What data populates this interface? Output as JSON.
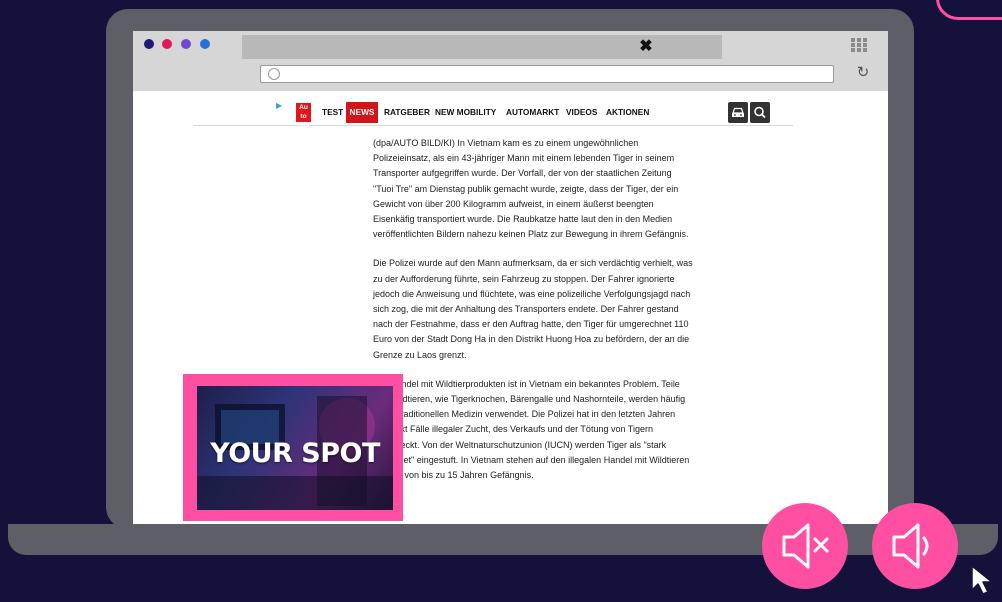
{
  "browser": {
    "tab_close_symbol": "✖",
    "reload_symbol": "↻",
    "traffic_dots": [
      "#1e1a78",
      "#e5145c",
      "#6c4bd0",
      "#2a6ed8"
    ]
  },
  "site": {
    "ad_marker": "▶",
    "logo_text": "Auto Bild",
    "nav_items": [
      "TEST",
      "NEWS",
      "RATGEBER",
      "NEW MOBILITY",
      "AUTOMARKT",
      "VIDEOS",
      "AKTIONEN"
    ],
    "active_nav": "NEWS"
  },
  "article": {
    "paragraphs": [
      "(dpa/AUTO BILD/KI) In Vietnam kam es zu einem ungewöhnlichen Polizeieinsatz, als ein 43-jähriger Mann mit einem lebenden Tiger in seinem Transporter aufgegriffen wurde. Der Vorfall, der von der staatlichen Zeitung \"Tuoi Tre\" am Dienstag publik gemacht wurde, zeigte, dass der Tiger, der ein Gewicht von über 200 Kilogramm aufweist, in einem äußerst beengten Eisenkäfig transportiert wurde. Die Raubkatze hatte laut den in den Medien veröffentlichten Bildern nahezu keinen Platz zur Bewegung in ihrem Gefängnis.",
      "Die Polizei wurde auf den Mann aufmerksam, da er sich verdächtig verhielt, was zu der Aufforderung führte, sein Fahrzeug zu stoppen. Der Fahrer ignorierte jedoch die Anweisung und flüchtete, was eine polizeiliche Verfolgungsjagd nach sich zog, die mit der Anhaltung des Transporters endete. Der Fahrer gestand nach der Festnahme, dass er den Auftrag hatte, den Tiger für umgerechnet 110 Euro von der Stadt Dong Ha in den Distrikt Huong Hoa zu befördern, der an die Grenze zu Laos grenzt.",
      "Der Handel mit Wildtierprodukten ist in Vietnam ein bekanntes Problem. Teile von Wildtieren, wie Tigerknochen, Bärengalle und Nashornteile, werden häufig in der traditionellen Medizin verwendet. Die Polizei hat in den letzten Jahren verstärkt Fälle illegaler Zucht, des Verkaufs und der Tötung von Tigern aufgedeckt. Von der Weltnaturschutzunion (IUCN) werden Tiger als \"stark gefährdet\" eingestuft. In Vietnam stehen auf den illegalen Handel mit Wildtieren Strafen von bis zu 15 Jahren Gefängnis."
    ]
  },
  "ad": {
    "label": "YOUR SPOT",
    "border_color": "#ff4fa3"
  },
  "controls": {
    "mute_icon": "speaker-muted-icon",
    "unmute_icon": "speaker-on-icon",
    "accent": "#ff4fa3"
  }
}
